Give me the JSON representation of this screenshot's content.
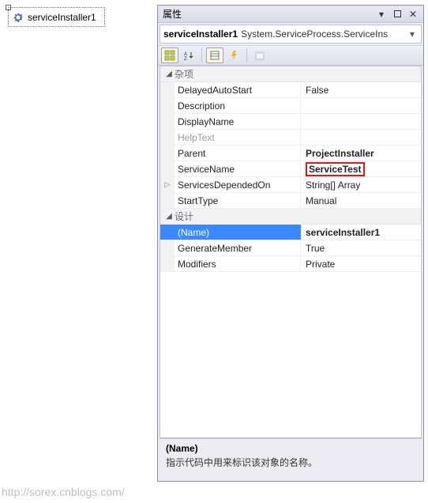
{
  "designer": {
    "component_label": "serviceInstaller1"
  },
  "panel": {
    "title": "属性",
    "object": {
      "name": "serviceInstaller1",
      "type": "System.ServiceProcess.ServiceIns"
    }
  },
  "categories": {
    "misc": {
      "label": "杂项",
      "rows": {
        "delayedAutoStart": {
          "name": "DelayedAutoStart",
          "value": "False"
        },
        "description": {
          "name": "Description",
          "value": ""
        },
        "displayName": {
          "name": "DisplayName",
          "value": ""
        },
        "helpText": {
          "name": "HelpText",
          "value": ""
        },
        "parent": {
          "name": "Parent",
          "value": "ProjectInstaller"
        },
        "serviceName": {
          "name": "ServiceName",
          "value": "ServiceTest"
        },
        "servicesDependedOn": {
          "name": "ServicesDependedOn",
          "value": "String[] Array"
        },
        "startType": {
          "name": "StartType",
          "value": "Manual"
        }
      }
    },
    "design": {
      "label": "设计",
      "rows": {
        "name": {
          "name": "(Name)",
          "value": "serviceInstaller1"
        },
        "generateMember": {
          "name": "GenerateMember",
          "value": "True"
        },
        "modifiers": {
          "name": "Modifiers",
          "value": "Private"
        }
      }
    }
  },
  "description": {
    "title": "(Name)",
    "text": "指示代码中用来标识该对象的名称。"
  },
  "watermark": "http://sorex.cnblogs.com/"
}
